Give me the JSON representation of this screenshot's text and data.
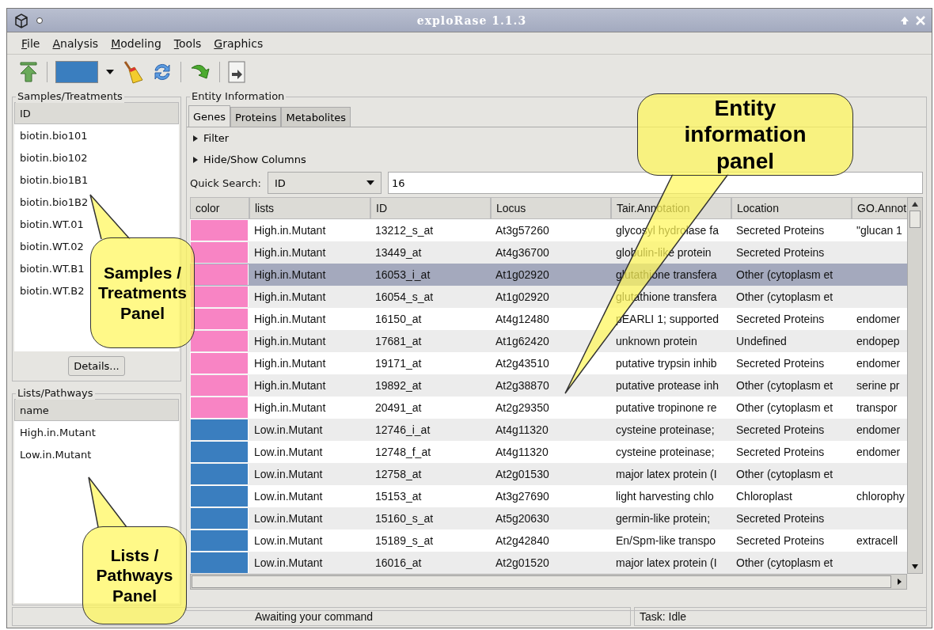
{
  "window": {
    "title": "exploRase 1.1.3"
  },
  "menu": [
    "File",
    "Analysis",
    "Modeling",
    "Tools",
    "Graphics"
  ],
  "toolbar": {
    "color_swatch": {
      "color": "#3a7ebf"
    }
  },
  "samples": {
    "title": "Samples/Treatments",
    "header": "ID",
    "items": [
      "biotin.bio101",
      "biotin.bio102",
      "biotin.bio1B1",
      "biotin.bio1B2",
      "biotin.WT.01",
      "biotin.WT.02",
      "biotin.WT.B1",
      "biotin.WT.B2"
    ],
    "button": "Details..."
  },
  "lists": {
    "title": "Lists/Pathways",
    "header": "name",
    "items": [
      "High.in.Mutant",
      "Low.in.Mutant"
    ]
  },
  "entity": {
    "title": "Entity Information",
    "tabs": [
      {
        "label": "Genes",
        "selected": true
      },
      {
        "label": "Proteins",
        "selected": false
      },
      {
        "label": "Metabolites",
        "selected": false
      }
    ],
    "expanders": [
      {
        "label": "Filter",
        "expanded": false
      },
      {
        "label": "Hide/Show Columns",
        "expanded": false
      }
    ],
    "quick_search": {
      "label": "Quick Search:",
      "field": "ID",
      "value": "16"
    },
    "columns": [
      "color",
      "lists",
      "ID",
      "Locus",
      "Tair.Annotation",
      "Location",
      "GO.Annot"
    ],
    "rows": [
      {
        "color": "#f884c4",
        "list": "High.in.Mutant",
        "id": "13212_s_at",
        "locus": "At3g57260",
        "annotation": "glycosyl hydrolase fa",
        "location": "Secreted Proteins",
        "go": "\"glucan 1",
        "selected": false
      },
      {
        "color": "#f884c4",
        "list": "High.in.Mutant",
        "id": "13449_at",
        "locus": "At4g36700",
        "annotation": "globulin-like protein",
        "location": "Secreted Proteins",
        "selected": false
      },
      {
        "color": "#f884c4",
        "list": "High.in.Mutant",
        "id": "16053_i_at",
        "locus": "At1g02920",
        "annotation": "glutathione transfera",
        "location": "Other (cytoplasm et",
        "selected": true
      },
      {
        "color": "#f884c4",
        "list": "High.in.Mutant",
        "id": "16054_s_at",
        "locus": "At1g02920",
        "annotation": "glutathione transfera",
        "location": "Other (cytoplasm et",
        "selected": false
      },
      {
        "color": "#f884c4",
        "list": "High.in.Mutant",
        "id": "16150_at",
        "locus": "At4g12480",
        "annotation": "pEARLI 1; supported",
        "location": "Secreted Proteins",
        "go": "endomer",
        "selected": false
      },
      {
        "color": "#f884c4",
        "list": "High.in.Mutant",
        "id": "17681_at",
        "locus": "At1g62420",
        "annotation": "unknown protein",
        "location": "Undefined",
        "go": "endopep",
        "selected": false
      },
      {
        "color": "#f884c4",
        "list": "High.in.Mutant",
        "id": "19171_at",
        "locus": "At2g43510",
        "annotation": "putative trypsin inhib",
        "location": "Secreted Proteins",
        "go": "endomer",
        "selected": false
      },
      {
        "color": "#f884c4",
        "list": "High.in.Mutant",
        "id": "19892_at",
        "locus": "At2g38870",
        "annotation": "putative protease inh",
        "location": "Other (cytoplasm et",
        "go": "serine pr",
        "selected": false
      },
      {
        "color": "#f884c4",
        "list": "High.in.Mutant",
        "id": "20491_at",
        "locus": "At2g29350",
        "annotation": "putative tropinone re",
        "location": "Other (cytoplasm et",
        "go": "transpor",
        "selected": false
      },
      {
        "color": "#3a7ebf",
        "list": "Low.in.Mutant",
        "id": "12746_i_at",
        "locus": "At4g11320",
        "annotation": "cysteine proteinase;",
        "location": "Secreted Proteins",
        "go": "endomer",
        "selected": false
      },
      {
        "color": "#3a7ebf",
        "list": "Low.in.Mutant",
        "id": "12748_f_at",
        "locus": "At4g11320",
        "annotation": "cysteine proteinase;",
        "location": "Secreted Proteins",
        "go": "endomer",
        "selected": false
      },
      {
        "color": "#3a7ebf",
        "list": "Low.in.Mutant",
        "id": "12758_at",
        "locus": "At2g01530",
        "annotation": "major latex protein (I",
        "location": "Other (cytoplasm et",
        "selected": false
      },
      {
        "color": "#3a7ebf",
        "list": "Low.in.Mutant",
        "id": "15153_at",
        "locus": "At3g27690",
        "annotation": "light harvesting chlo",
        "location": "Chloroplast",
        "go": "chlorophy",
        "selected": false
      },
      {
        "color": "#3a7ebf",
        "list": "Low.in.Mutant",
        "id": "15160_s_at",
        "locus": "At5g20630",
        "annotation": "germin-like protein;",
        "location": "Secreted Proteins",
        "selected": false
      },
      {
        "color": "#3a7ebf",
        "list": "Low.in.Mutant",
        "id": "15189_s_at",
        "locus": "At2g42840",
        "annotation": "En/Spm-like transpo",
        "location": "Secreted Proteins",
        "go": "extracell",
        "selected": false
      },
      {
        "color": "#3a7ebf",
        "list": "Low.in.Mutant",
        "id": "16016_at",
        "locus": "At2g01520",
        "annotation": "major latex protein (I",
        "location": "Other (cytoplasm et",
        "selected": false
      }
    ]
  },
  "status_bar": {
    "message": "Awaiting your command",
    "task": "Task: Idle"
  },
  "callouts": [
    {
      "lines": [
        "Samples /",
        "Treatments",
        "Panel"
      ]
    },
    {
      "lines": [
        "Entity",
        "information",
        "panel"
      ]
    },
    {
      "lines": [
        "Lists /",
        "Pathways",
        "Panel"
      ]
    }
  ]
}
